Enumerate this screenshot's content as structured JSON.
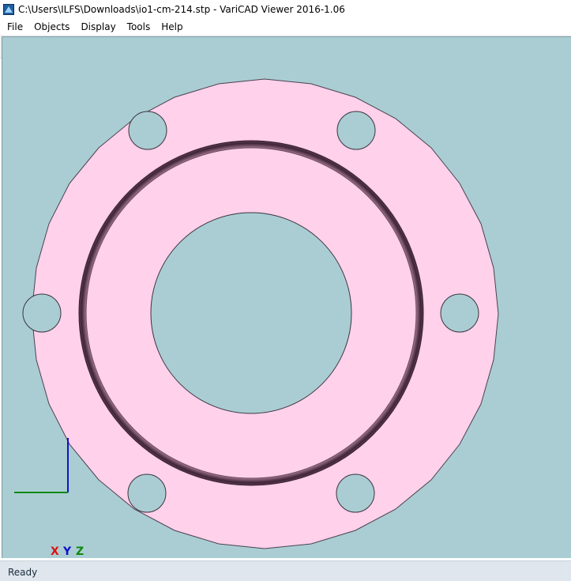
{
  "window": {
    "title": "C:\\Users\\ILFS\\Downloads\\io1-cm-214.stp - VariCAD Viewer 2016-1.06",
    "app_icon": "varicad-app-icon"
  },
  "menu": [
    "File",
    "Objects",
    "Display",
    "Tools",
    "Help"
  ],
  "toolbar": {
    "buttons": [
      "home-icon",
      "open-folder-icon",
      "save-icon",
      "properties-icon",
      "measure-icon",
      "print-icon",
      "undo-icon",
      "redo-icon",
      "zoom-select-icon",
      "move-object-icon",
      "rotate-view-icon",
      "axes-icon",
      "select-plane-icon",
      "section-icon",
      "box-view-icon",
      "cylinder-view-icon",
      "points-icon",
      "fit-window-icon",
      "swap-icon",
      "layers-icon",
      "settings-icon",
      "view-cube-1-icon",
      "view-cube-2-icon",
      "view-cube-red-icon",
      "view-cube-3-icon",
      "view-cube-4-icon",
      "view-cube-red-2-icon"
    ]
  },
  "colors": {
    "viewport_bg": "#aacdd3",
    "part_fill": "#ffd1ea",
    "part_edge": "#3a3440",
    "groove_dark": "#4a2d40",
    "axis_x": "#dd1111",
    "axis_y": "#1111cc",
    "axis_z": "#118811"
  },
  "axes": {
    "x": "X",
    "y": "Y",
    "z": "Z"
  },
  "status": {
    "text": "Ready"
  }
}
